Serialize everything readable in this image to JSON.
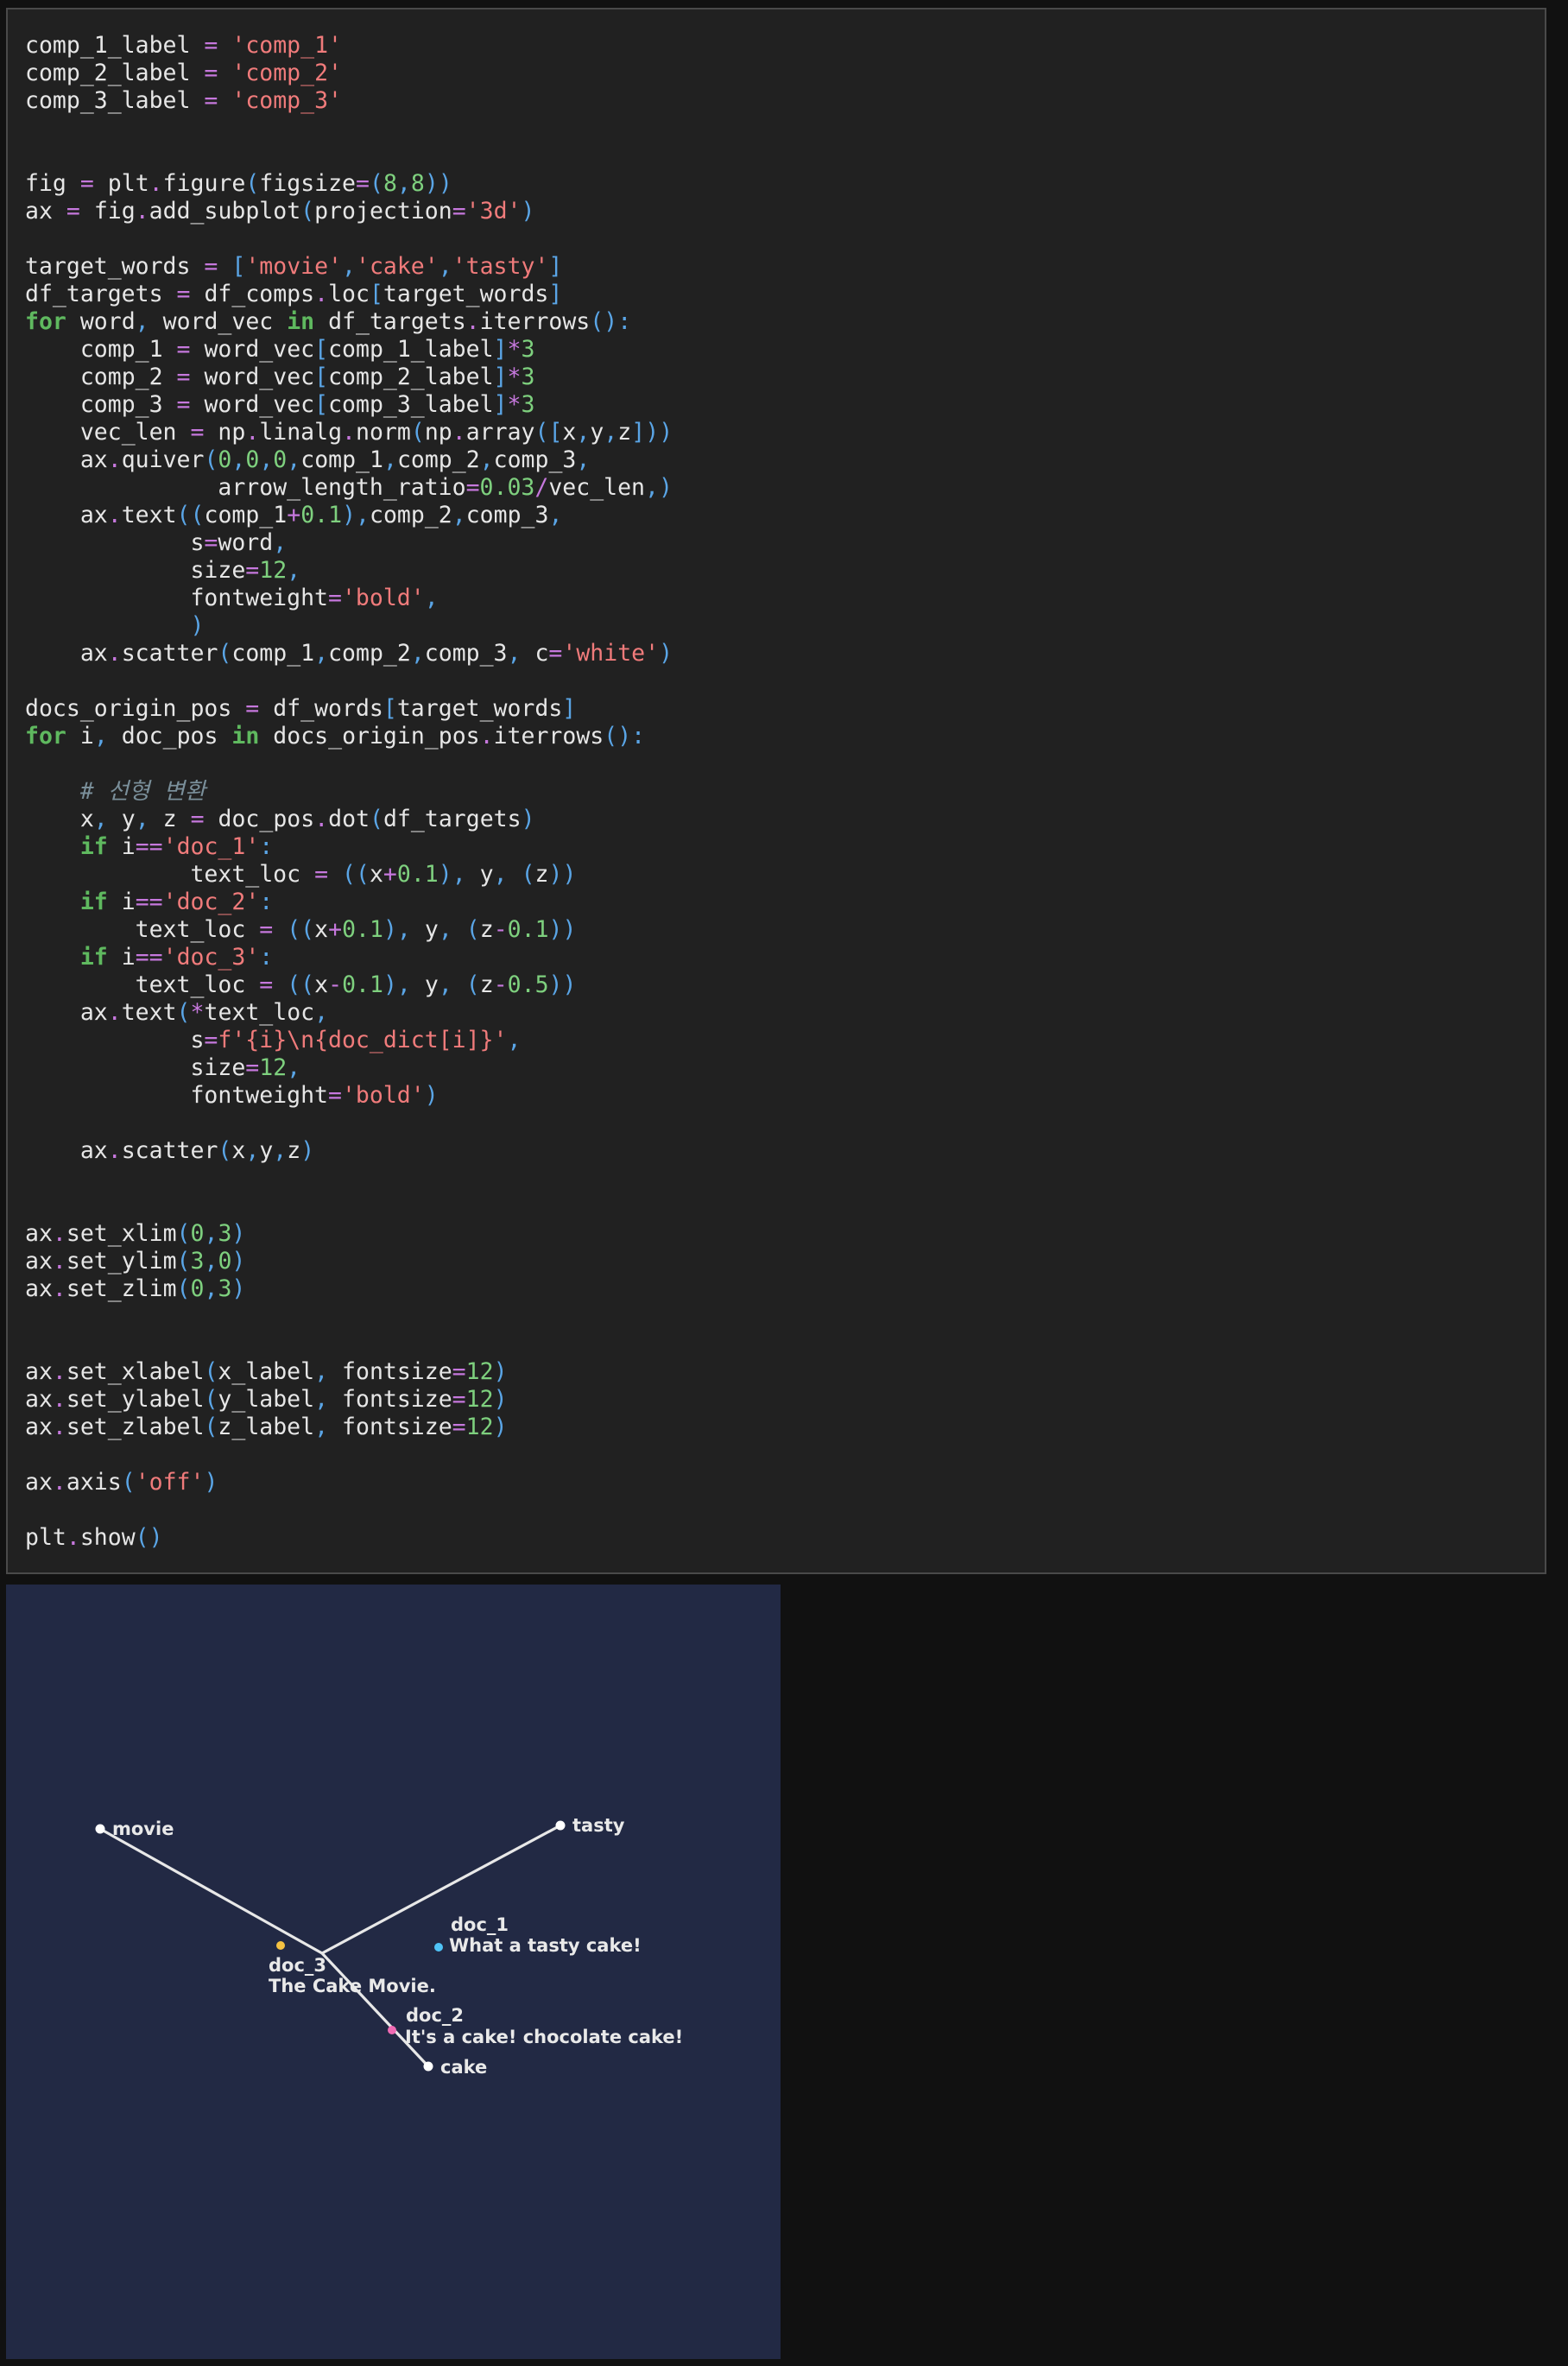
{
  "code_cell": {
    "lines": [
      "comp_1_label = 'comp_1'",
      "comp_2_label = 'comp_2'",
      "comp_3_label = 'comp_3'",
      "",
      "",
      "fig = plt.figure(figsize=(8,8))",
      "ax = fig.add_subplot(projection='3d')",
      "",
      "target_words = ['movie','cake','tasty']",
      "df_targets = df_comps.loc[target_words]",
      "for word, word_vec in df_targets.iterrows():",
      "    comp_1 = word_vec[comp_1_label]*3",
      "    comp_2 = word_vec[comp_2_label]*3",
      "    comp_3 = word_vec[comp_3_label]*3",
      "    vec_len = np.linalg.norm(np.array([x,y,z]))",
      "    ax.quiver(0,0,0,comp_1,comp_2,comp_3,",
      "              arrow_length_ratio=0.03/vec_len,)",
      "    ax.text((comp_1+0.1),comp_2,comp_3,",
      "            s=word,",
      "            size=12,",
      "            fontweight='bold',",
      "            )",
      "    ax.scatter(comp_1,comp_2,comp_3, c='white')",
      "",
      "docs_origin_pos = df_words[target_words]",
      "for i, doc_pos in docs_origin_pos.iterrows():",
      "",
      "    # 선형 변환",
      "    x, y, z = doc_pos.dot(df_targets)",
      "    if i=='doc_1':",
      "            text_loc = ((x+0.1), y, (z))",
      "    if i=='doc_2':",
      "        text_loc = ((x+0.1), y, (z-0.1))",
      "    if i=='doc_3':",
      "        text_loc = ((x-0.1), y, (z-0.5))",
      "    ax.text(*text_loc,",
      "            s=f'{i}\\n{doc_dict[i]}',",
      "            size=12,",
      "            fontweight='bold')",
      "",
      "    ax.scatter(x,y,z)",
      "",
      "",
      "ax.set_xlim(0,3)",
      "ax.set_ylim(3,0)",
      "ax.set_zlim(0,3)",
      "",
      "",
      "ax.set_xlabel(x_label, fontsize=12)",
      "ax.set_ylabel(y_label, fontsize=12)",
      "ax.set_zlabel(z_label, fontsize=12)",
      "",
      "ax.axis('off')",
      "",
      "plt.show()"
    ]
  },
  "output_plot": {
    "background": "#222944",
    "word_vectors": [
      {
        "word": "movie",
        "color": "#ffffff"
      },
      {
        "word": "tasty",
        "color": "#ffffff"
      },
      {
        "word": "cake",
        "color": "#ffffff"
      }
    ],
    "documents": [
      {
        "id": "doc_1",
        "text": "What a tasty cake!",
        "color": "#4fc3f7"
      },
      {
        "id": "doc_3",
        "text": "The Cake Movie.",
        "color": "#f5c242"
      },
      {
        "id": "doc_2",
        "text": "It's a cake! chocolate cake!",
        "color": "#f06bb4"
      }
    ],
    "line_color": "#e8e8e8",
    "text_color": "#e9e9e9"
  },
  "colors": {
    "page_bg": "#111111",
    "cell_bg": "#212121",
    "cell_border": "#4a4a4a",
    "keyword": "#5fb95f",
    "string": "#f07b7b",
    "number": "#7ed07e",
    "operator": "#c678dd",
    "punctuation": "#5aa5e6",
    "comment": "#7a8f9a",
    "identifier": "#e6e6e6"
  }
}
